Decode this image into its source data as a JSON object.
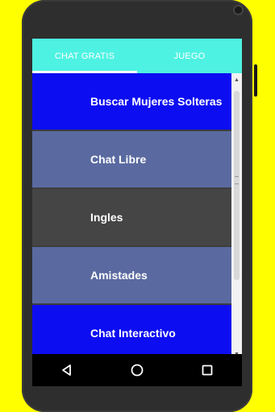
{
  "tabs": [
    {
      "label": "CHAT GRATIS",
      "selected": true
    },
    {
      "label": "JUEGO",
      "selected": false
    }
  ],
  "items": [
    {
      "label": "Buscar Mujeres Solteras",
      "color": "#0d0df2"
    },
    {
      "label": "Chat Libre",
      "color": "#5a6aa0"
    },
    {
      "label": "Ingles",
      "color": "#454545"
    },
    {
      "label": "Amistades",
      "color": "#5a6aa0"
    },
    {
      "label": "Chat Interactivo",
      "color": "#0d0df2"
    }
  ],
  "navbar": {
    "back_icon": "back-triangle-icon",
    "home_icon": "home-circle-icon",
    "recents_icon": "recents-square-icon"
  },
  "colors": {
    "background": "#ffff00",
    "tab_bar": "#4ef2e2"
  }
}
